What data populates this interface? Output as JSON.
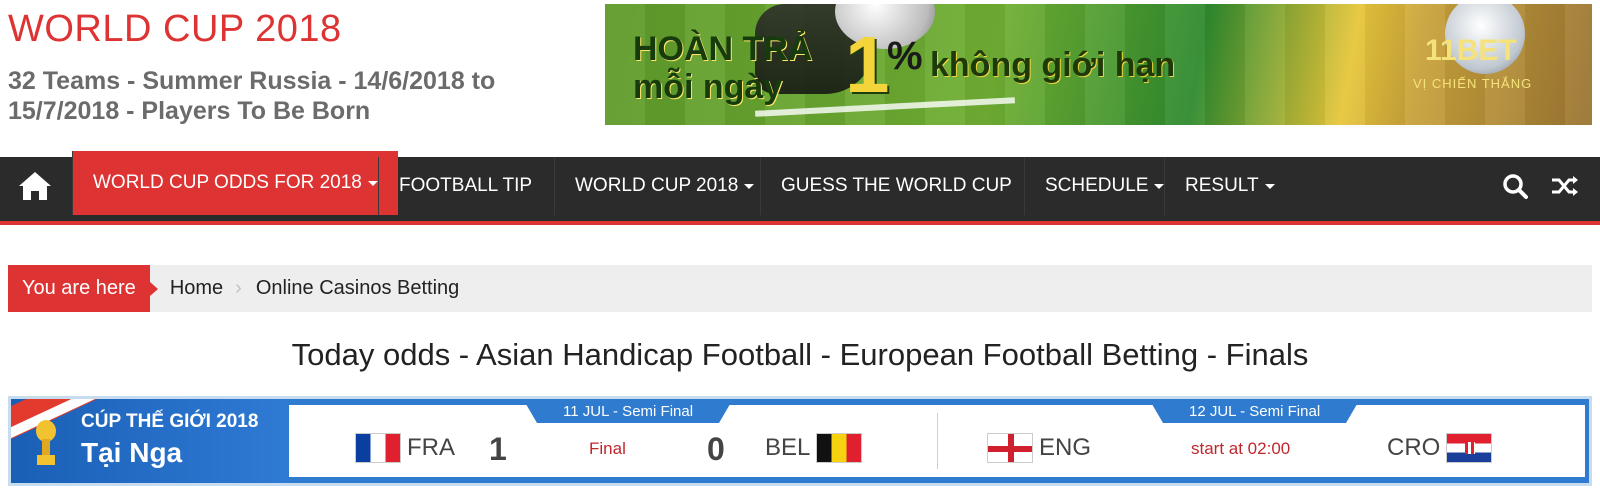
{
  "header": {
    "site_title": "WORLD CUP 2018",
    "tagline": "32 Teams - Summer Russia - 14/6/2018 to 15/7/2018 - Players To Be Born",
    "banner": {
      "line1": "HOÀN TRẢ",
      "line2": "mỗi ngày",
      "big": "1",
      "pct": "%",
      "rest": "không giới hạn",
      "brand": "11BET",
      "brand_sub": "VỊ CHIẾN THẮNG"
    }
  },
  "nav": {
    "items": [
      {
        "label": "WORLD CUP ODDS FOR 2018",
        "dropdown": true
      },
      {
        "label": "FOOTBALL TIP",
        "dropdown": false
      },
      {
        "label": "WORLD CUP 2018",
        "dropdown": true
      },
      {
        "label": "GUESS THE WORLD CUP",
        "dropdown": false
      },
      {
        "label": "SCHEDULE",
        "dropdown": true
      },
      {
        "label": "RESULT",
        "dropdown": true
      }
    ],
    "accent": "#dd3333",
    "bg": "#2b2b2b"
  },
  "breadcrumb": {
    "label": "You are here",
    "items": [
      "Home",
      "Online Casinos Betting"
    ]
  },
  "page_title": "Today odds - Asian Handicap Football - European Football Betting - Finals",
  "scores": {
    "logo_line1": "CÚP THẾ GIỚI 2018",
    "logo_line2": "Tại Nga",
    "matches": [
      {
        "stage": "11 JUL - Semi Final",
        "home": "FRA",
        "home_score": "1",
        "status": "Final",
        "away_score": "0",
        "away": "BEL"
      },
      {
        "stage": "12 JUL - Semi Final",
        "home": "ENG",
        "home_score": "",
        "status": "start at 02:00",
        "away_score": "",
        "away": "CRO"
      }
    ]
  }
}
